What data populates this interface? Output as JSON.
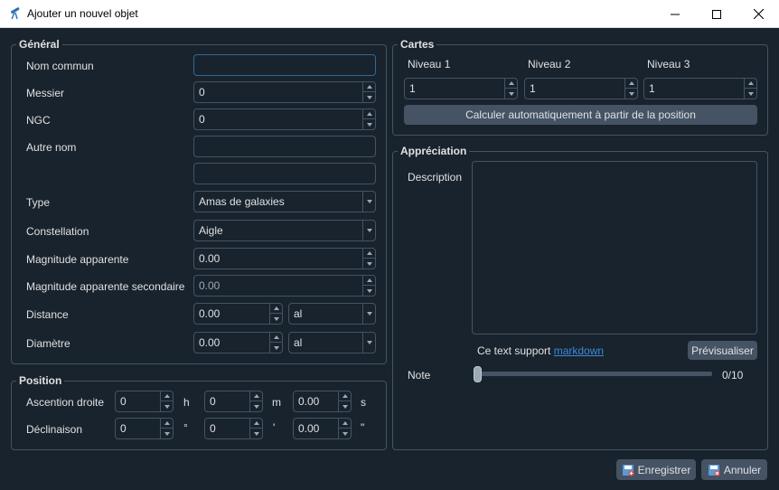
{
  "window": {
    "title": "Ajouter un nouvel objet",
    "minimize_icon": "minimize-icon",
    "maximize_icon": "maximize-icon",
    "close_icon": "close-icon",
    "app_icon": "telescope-icon"
  },
  "general": {
    "title": "Général",
    "common_name": {
      "label": "Nom commun",
      "value": ""
    },
    "messier": {
      "label": "Messier",
      "value": "0"
    },
    "ngc": {
      "label": "NGC",
      "value": "0"
    },
    "other_name": {
      "label": "Autre nom",
      "value1": "",
      "value2": ""
    },
    "type": {
      "label": "Type",
      "value": "Amas de galaxies"
    },
    "constellation": {
      "label": "Constellation",
      "value": "Aigle"
    },
    "apparent_magnitude": {
      "label": "Magnitude apparente",
      "value": "0.00"
    },
    "secondary_magnitude": {
      "label": "Magnitude apparente secondaire",
      "value": "0.00"
    },
    "distance": {
      "label": "Distance",
      "value": "0.00",
      "unit": "al"
    },
    "diameter": {
      "label": "Diamètre",
      "value": "0.00",
      "unit": "al"
    }
  },
  "position": {
    "title": "Position",
    "ra": {
      "label": "Ascention droite",
      "h": "0",
      "h_unit": "h",
      "m": "0",
      "m_unit": "m",
      "s": "0.00",
      "s_unit": "s"
    },
    "dec": {
      "label": "Déclinaison",
      "d": "0",
      "d_unit": "°",
      "m": "0",
      "m_unit": "'",
      "s": "0.00",
      "s_unit": "\""
    }
  },
  "maps": {
    "title": "Cartes",
    "level1": {
      "label": "Niveau 1",
      "value": "1"
    },
    "level2": {
      "label": "Niveau 2",
      "value": "1"
    },
    "level3": {
      "label": "Niveau 3",
      "value": "1"
    },
    "auto_button": "Calculer automatiquement à partir de la position"
  },
  "rating": {
    "title": "Appréciation",
    "description_label": "Description",
    "description_value": "",
    "support_text": "Ce text support",
    "markdown_link": "markdown",
    "preview_button": "Prévisualiser",
    "note_label": "Note",
    "note_value": "0/10",
    "note_level": 0
  },
  "footer": {
    "save_button": "Enregistrer",
    "cancel_button": "Annuler"
  },
  "colors": {
    "background": "#19232d",
    "border": "#455364",
    "focus_border": "#346792",
    "button": "#455364",
    "link": "#3b8ad8"
  }
}
